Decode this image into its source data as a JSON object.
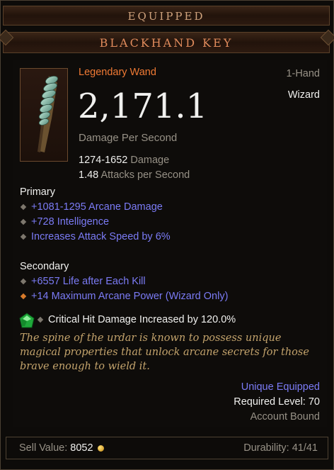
{
  "header": {
    "section": "EQUIPPED",
    "item_name": "BLACKHAND KEY"
  },
  "item": {
    "type": "Legendary Wand",
    "slot": "1-Hand",
    "class": "Wizard",
    "dps": "2,171.1",
    "dps_label": "Damage Per Second",
    "damage_range": "1274-1652",
    "damage_label": "Damage",
    "attack_speed": "1.48",
    "attack_speed_label": "Attacks per Second"
  },
  "primary": {
    "label": "Primary",
    "stats": [
      "+1081-1295 Arcane Damage",
      "+728 Intelligence",
      "Increases Attack Speed by 6%"
    ]
  },
  "secondary": {
    "label": "Secondary",
    "stats": [
      "+6557 Life after Each Kill",
      "+14 Maximum Arcane Power (Wizard Only)"
    ]
  },
  "socket": {
    "gem_icon": "emerald-gem-icon",
    "text": "Critical Hit Damage Increased by 120.0%"
  },
  "flavor": "The spine of the urdar is known to possess unique magical properties that unlock arcane secrets for those brave enough to wield it.",
  "requirements": {
    "unique": "Unique Equipped",
    "level": "Required Level: 70",
    "bound": "Account Bound"
  },
  "footer": {
    "sell_label": "Sell Value:",
    "sell_value": "8052",
    "durability": "Durability: 41/41",
    "gold_icon": "gold-coin-icon"
  },
  "colors": {
    "legendary": "#f07a34",
    "magic": "#7b7bf5",
    "flavor": "#c3a36c",
    "header": "#d9b087"
  }
}
